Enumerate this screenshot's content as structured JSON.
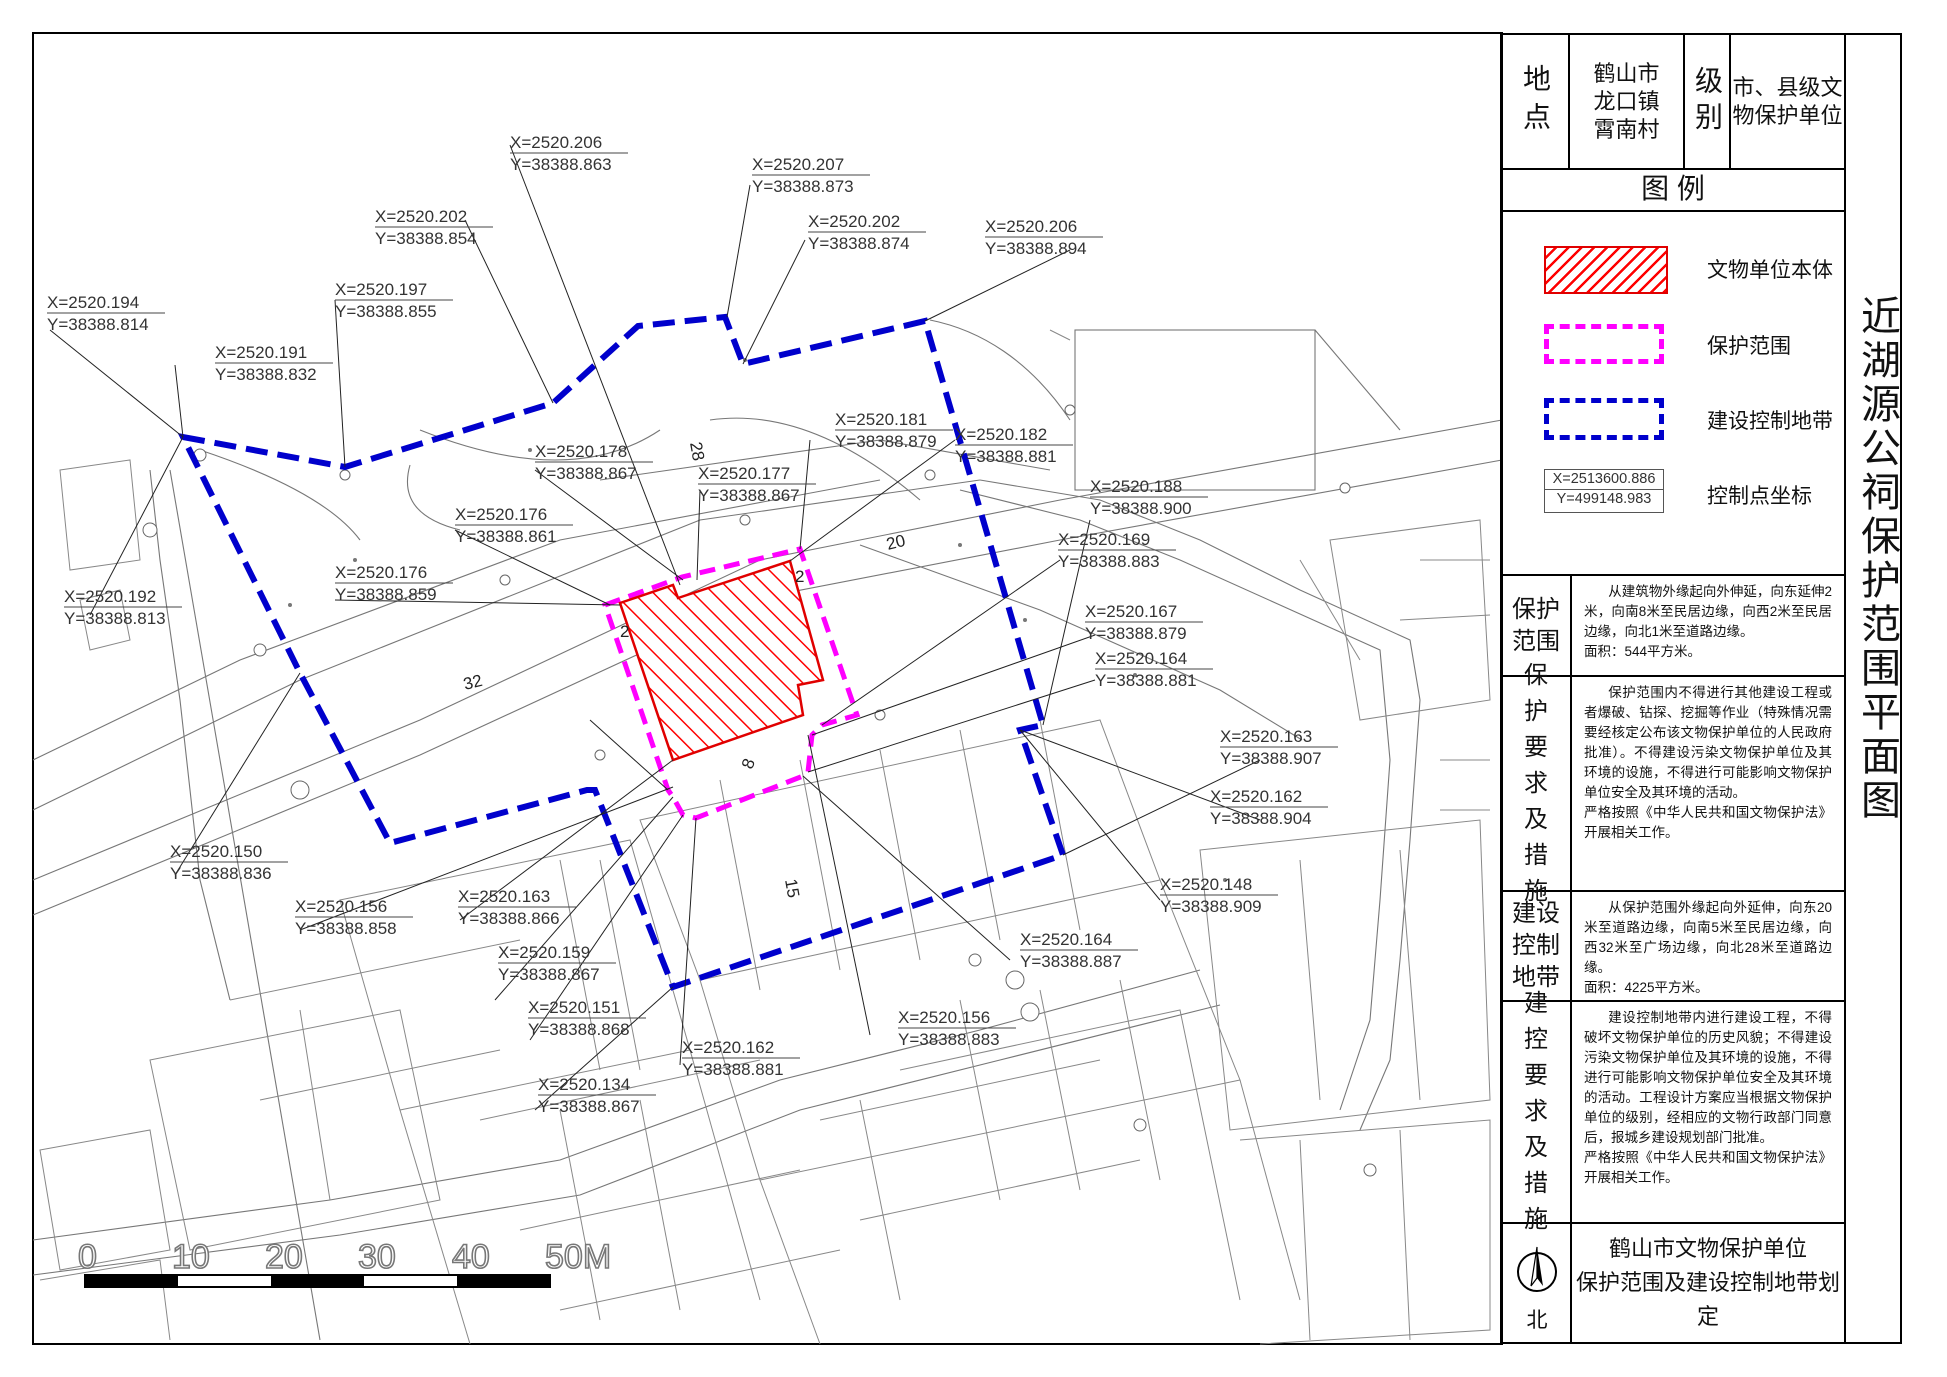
{
  "map": {
    "title": "近湖源公祠保护范围平面图",
    "info": {
      "location_label": "地点",
      "location_value": "鹤山市\n龙口镇\n霄南村",
      "level_label": "级别",
      "level_value": "市、县级文\n物保护单位"
    },
    "legend": {
      "title": "图  例",
      "items": [
        {
          "label": "文物单位本体",
          "color": "#ff0000"
        },
        {
          "label": "保护范围",
          "color": "#ff00ff"
        },
        {
          "label": "建设控制地带",
          "color": "#0000cc"
        },
        {
          "label": "控制点坐标",
          "sample_x": "X=2513600.886",
          "sample_y": "Y=499148.983"
        }
      ]
    },
    "sections": [
      {
        "header": "保护范围",
        "text": "从建筑物外缘起向外伸延，向东延伸2米，向南8米至民居边缘，向西2米至民居边缘，向北1米至道路边缘。\n面积：544平方米。"
      },
      {
        "header": "保护要求及措施",
        "text": "保护范围内不得进行其他建设工程或者爆破、钻探、挖掘等作业（特殊情况需要经核定公布该文物保护单位的人民政府批准）。不得建设污染文物保护单位及其环境的设施，不得进行可能影响文物保护单位安全及其环境的活动。\n严格按照《中华人民共和国文物保护法》开展相关工作。"
      },
      {
        "header": "建设控制地带",
        "text": "从保护范围外缘起向外延伸，向东20米至道路边缘，向南5米至民居边缘，向西32米至广场边缘，向北28米至道路边缘。\n面积：4225平方米。"
      },
      {
        "header": "建控要求及措施",
        "text": "建设控制地带内进行建设工程，不得破坏文物保护单位的历史风貌；不得建设污染文物保护单位及其环境的设施，不得进行可能影响文物保护单位安全及其环境的活动。工程设计方案应当根据文物保护单位的级别，经相应的文物行政部门同意后，报城乡建设规划部门批准。\n严格按照《中华人民共和国文物保护法》开展相关工作。"
      }
    ],
    "north_label": "北",
    "footer": "鹤山市文物保护单位\n保护范围及建设控制地带划定",
    "scale": {
      "labels": [
        "0",
        "10",
        "20",
        "30",
        "40",
        "50M"
      ]
    },
    "dimensions": [
      "28",
      "20",
      "32",
      "2",
      "2",
      "8",
      "15"
    ],
    "coordinates": [
      {
        "x": "X=2520.206",
        "y": "Y=38388.863"
      },
      {
        "x": "X=2520.207",
        "y": "Y=38388.873"
      },
      {
        "x": "X=2520.202",
        "y": "Y=38388.854"
      },
      {
        "x": "X=2520.202",
        "y": "Y=38388.874"
      },
      {
        "x": "X=2520.206",
        "y": "Y=38388.894"
      },
      {
        "x": "X=2520.197",
        "y": "Y=38388.855"
      },
      {
        "x": "X=2520.194",
        "y": "Y=38388.814"
      },
      {
        "x": "X=2520.191",
        "y": "Y=38388.832"
      },
      {
        "x": "X=2520.181",
        "y": "Y=38388.879"
      },
      {
        "x": "X=2520.182",
        "y": "Y=38388.881"
      },
      {
        "x": "X=2520.178",
        "y": "Y=38388.867"
      },
      {
        "x": "X=2520.177",
        "y": "Y=38388.867"
      },
      {
        "x": "X=2520.188",
        "y": "Y=38388.900"
      },
      {
        "x": "X=2520.176",
        "y": "Y=38388.861"
      },
      {
        "x": "X=2520.169",
        "y": "Y=38388.883"
      },
      {
        "x": "X=2520.176",
        "y": "Y=38388.859"
      },
      {
        "x": "X=2520.192",
        "y": "Y=38388.813"
      },
      {
        "x": "X=2520.167",
        "y": "Y=38388.879"
      },
      {
        "x": "X=2520.164",
        "y": "Y=38388.881"
      },
      {
        "x": "X=2520.163",
        "y": "Y=38388.907"
      },
      {
        "x": "X=2520.162",
        "y": "Y=38388.904"
      },
      {
        "x": "X=2520.150",
        "y": "Y=38388.836"
      },
      {
        "x": "X=2520.148",
        "y": "Y=38388.909"
      },
      {
        "x": "X=2520.156",
        "y": "Y=38388.858"
      },
      {
        "x": "X=2520.163",
        "y": "Y=38388.866"
      },
      {
        "x": "X=2520.164",
        "y": "Y=38388.887"
      },
      {
        "x": "X=2520.159",
        "y": "Y=38388.867"
      },
      {
        "x": "X=2520.151",
        "y": "Y=38388.868"
      },
      {
        "x": "X=2520.156",
        "y": "Y=38388.883"
      },
      {
        "x": "X=2520.162",
        "y": "Y=38388.881"
      },
      {
        "x": "X=2520.134",
        "y": "Y=38388.867"
      }
    ]
  }
}
